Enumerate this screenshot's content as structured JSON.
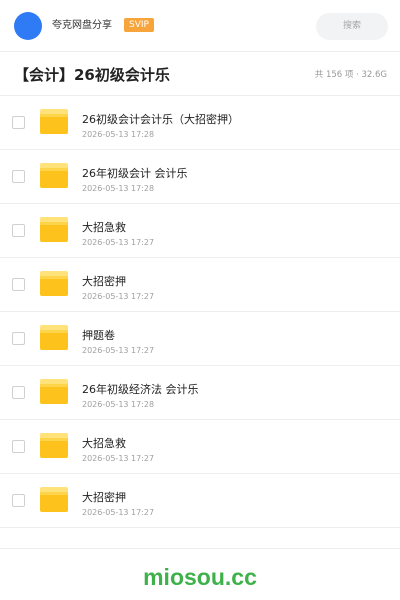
{
  "header": {
    "share_name": "夸克网盘分享",
    "badge": "SVIP",
    "search_placeholder": "搜索"
  },
  "folder": {
    "title": "【会计】26初级会计乐",
    "meta": "共 156 项 · 32.6G"
  },
  "items": [
    {
      "name": "26初级会计会计乐（大招密押）",
      "date": "2026-05-13 17:28"
    },
    {
      "name": "26年初级会计  会计乐",
      "date": "2026-05-13 17:28"
    },
    {
      "name": "大招急救",
      "date": "2026-05-13 17:27"
    },
    {
      "name": "大招密押",
      "date": "2026-05-13 17:27"
    },
    {
      "name": "押题卷",
      "date": "2026-05-13 17:27"
    },
    {
      "name": "26年初级经济法  会计乐",
      "date": "2026-05-13 17:28"
    },
    {
      "name": "大招急救",
      "date": "2026-05-13 17:27"
    },
    {
      "name": "大招密押",
      "date": "2026-05-13 17:27"
    }
  ],
  "watermark": "miosou.cc",
  "colors": {
    "avatar": "#2f7bf5",
    "svip": "#f7a43a",
    "folder": "#fdc21c",
    "watermark": "#3fb14b"
  }
}
